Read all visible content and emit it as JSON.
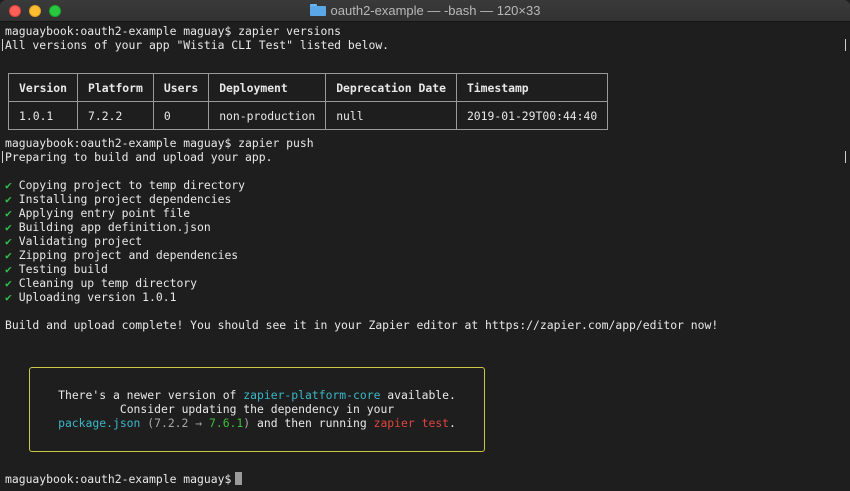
{
  "window": {
    "title": "oauth2-example — -bash — 120×33"
  },
  "terminal": {
    "cmd1": "maguaybook:oauth2-example maguay$ zapier versions",
    "cmd1_output": "All versions of your app \"Wistia CLI Test\" listed below.",
    "table": {
      "headers": [
        "Version",
        "Platform",
        "Users",
        "Deployment",
        "Deprecation Date",
        "Timestamp"
      ],
      "rows": [
        [
          "1.0.1",
          "7.2.2",
          "0",
          "non-production",
          "null",
          "2019-01-29T00:44:40"
        ]
      ]
    },
    "cmd2": "maguaybook:oauth2-example maguay$ zapier push",
    "cmd2_output": "Preparing to build and upload your app.",
    "check_glyph": "✔",
    "steps": [
      "Copying project to temp directory",
      "Installing project dependencies",
      "Applying entry point file",
      "Building app definition.json",
      "Validating project",
      "Zipping project and dependencies",
      "Testing build",
      "Cleaning up temp directory",
      "Uploading version 1.0.1"
    ],
    "complete_message": "Build and upload complete! You should see it in your Zapier editor at https://zapier.com/app/editor now!",
    "notice": {
      "line1_prefix": "There's a newer version of ",
      "line1_package": "zapier-platform-core",
      "line1_suffix": " available.",
      "line2": "Consider updating the dependency in your",
      "line3_file": "package.json",
      "line3_open": " (",
      "line3_old": "7.2.2",
      "line3_arrow": " → ",
      "line3_new": "7.6.1",
      "line3_close": ")",
      "line3_mid": " and then running ",
      "line3_cmd": "zapier test",
      "line3_end": "."
    },
    "prompt": "maguaybook:oauth2-example maguay$"
  }
}
